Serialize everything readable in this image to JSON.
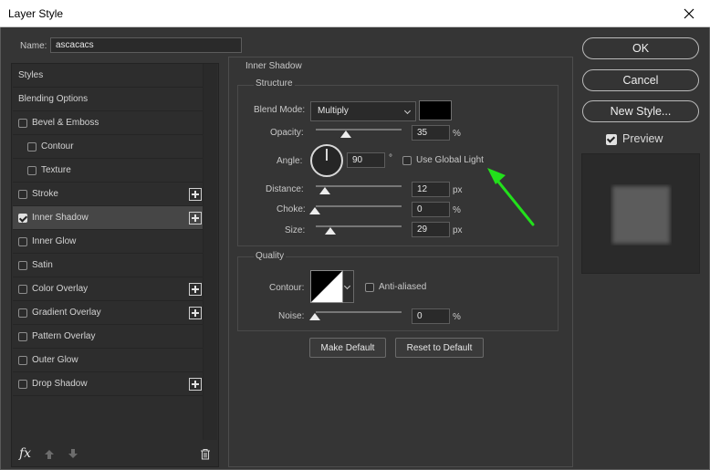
{
  "window": {
    "title": "Layer Style"
  },
  "name_field": {
    "label": "Name:",
    "value": "ascacacs"
  },
  "styles_list": [
    {
      "label": "Styles",
      "checkbox": false,
      "checked": false,
      "plus": false,
      "indent": false,
      "selected": false
    },
    {
      "label": "Blending Options",
      "checkbox": false,
      "checked": false,
      "plus": false,
      "indent": false,
      "selected": false
    },
    {
      "label": "Bevel & Emboss",
      "checkbox": true,
      "checked": false,
      "plus": false,
      "indent": false,
      "selected": false
    },
    {
      "label": "Contour",
      "checkbox": true,
      "checked": false,
      "plus": false,
      "indent": true,
      "selected": false
    },
    {
      "label": "Texture",
      "checkbox": true,
      "checked": false,
      "plus": false,
      "indent": true,
      "selected": false
    },
    {
      "label": "Stroke",
      "checkbox": true,
      "checked": false,
      "plus": true,
      "indent": false,
      "selected": false
    },
    {
      "label": "Inner Shadow",
      "checkbox": true,
      "checked": true,
      "plus": true,
      "indent": false,
      "selected": true
    },
    {
      "label": "Inner Glow",
      "checkbox": true,
      "checked": false,
      "plus": false,
      "indent": false,
      "selected": false
    },
    {
      "label": "Satin",
      "checkbox": true,
      "checked": false,
      "plus": false,
      "indent": false,
      "selected": false
    },
    {
      "label": "Color Overlay",
      "checkbox": true,
      "checked": false,
      "plus": true,
      "indent": false,
      "selected": false
    },
    {
      "label": "Gradient Overlay",
      "checkbox": true,
      "checked": false,
      "plus": true,
      "indent": false,
      "selected": false
    },
    {
      "label": "Pattern Overlay",
      "checkbox": true,
      "checked": false,
      "plus": false,
      "indent": false,
      "selected": false
    },
    {
      "label": "Outer Glow",
      "checkbox": true,
      "checked": false,
      "plus": false,
      "indent": false,
      "selected": false
    },
    {
      "label": "Drop Shadow",
      "checkbox": true,
      "checked": false,
      "plus": true,
      "indent": false,
      "selected": false
    }
  ],
  "bottom_tools": {
    "fx_label": "fx"
  },
  "inner_shadow": {
    "section_title": "Inner Shadow",
    "structure": {
      "title": "Structure",
      "blend_mode_label": "Blend Mode:",
      "blend_mode_value": "Multiply",
      "shadow_color": "#000000",
      "opacity_label": "Opacity:",
      "opacity_value": "35",
      "opacity_unit": "%",
      "angle_label": "Angle:",
      "angle_value": "90",
      "angle_unit": "°",
      "use_global_light_label": "Use Global Light",
      "use_global_light_checked": false,
      "distance_label": "Distance:",
      "distance_value": "12",
      "distance_unit": "px",
      "choke_label": "Choke:",
      "choke_value": "0",
      "choke_unit": "%",
      "size_label": "Size:",
      "size_value": "29",
      "size_unit": "px"
    },
    "quality": {
      "title": "Quality",
      "contour_label": "Contour:",
      "anti_aliased_label": "Anti-aliased",
      "anti_aliased_checked": false,
      "noise_label": "Noise:",
      "noise_value": "0",
      "noise_unit": "%"
    },
    "make_default_label": "Make Default",
    "reset_default_label": "Reset to Default"
  },
  "buttons": {
    "ok": "OK",
    "cancel": "Cancel",
    "new_style": "New Style..."
  },
  "preview": {
    "label": "Preview",
    "checked": true
  },
  "annotation": {
    "arrow_color": "#22e01b"
  }
}
